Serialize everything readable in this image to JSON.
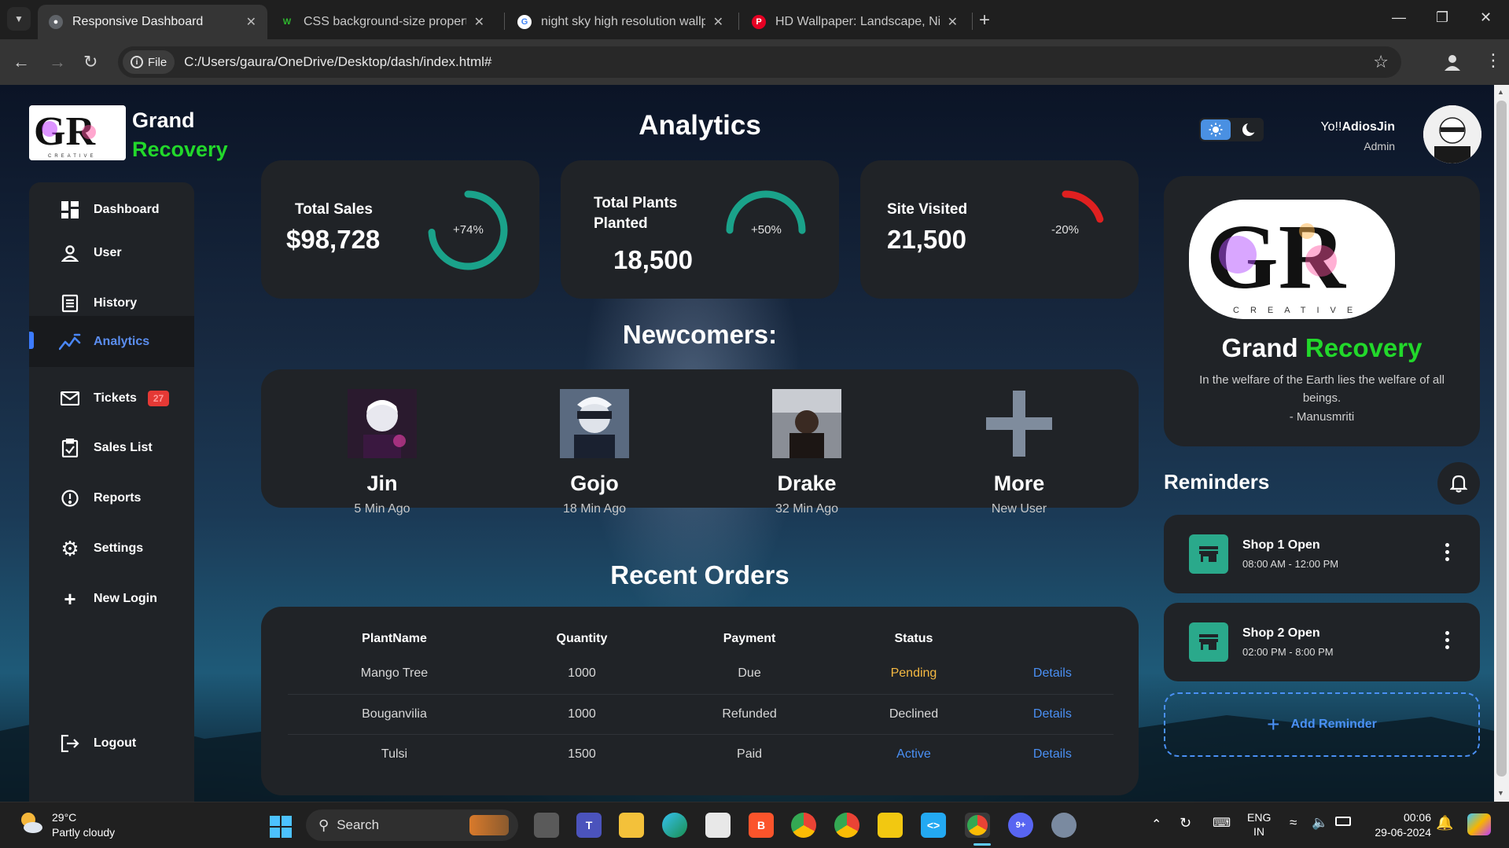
{
  "browser": {
    "tabs": [
      {
        "title": "Responsive Dashboard",
        "active": true
      },
      {
        "title": "CSS background-size property",
        "active": false
      },
      {
        "title": "night sky high resolution wallpa",
        "active": false
      },
      {
        "title": "HD Wallpaper: Landscape, Nigh",
        "active": false
      }
    ],
    "site_chip": "File",
    "url": "C:/Users/gaura/OneDrive/Desktop/dash/index.html#"
  },
  "brand": {
    "line1": "Grand",
    "line2": "Recovery"
  },
  "sidebar": {
    "items": [
      {
        "label": "Dashboard",
        "icon": "dashboard-icon"
      },
      {
        "label": "User",
        "icon": "user-icon"
      },
      {
        "label": "History",
        "icon": "history-icon"
      },
      {
        "label": "Analytics",
        "icon": "analytics-icon",
        "active": true
      },
      {
        "label": "Tickets",
        "icon": "mail-icon",
        "badge": "27"
      },
      {
        "label": "Sales List",
        "icon": "clipboard-icon"
      },
      {
        "label": "Reports",
        "icon": "report-icon"
      },
      {
        "label": "Settings",
        "icon": "gear-icon"
      },
      {
        "label": "New Login",
        "icon": "plus-icon"
      },
      {
        "label": "Logout",
        "icon": "logout-icon"
      }
    ]
  },
  "main": {
    "title": "Analytics",
    "stats": [
      {
        "label": "Total Sales",
        "value": "$98,728",
        "change": "+74%",
        "fraction": 0.74,
        "color": "#1aa28a"
      },
      {
        "label_line1": "Total Plants",
        "label_line2": "Planted",
        "value": "18,500",
        "change": "+50%",
        "fraction": 0.5,
        "color": "#1aa28a"
      },
      {
        "label": "Site Visited",
        "value": "21,500",
        "change": "-20%",
        "fraction": 0.2,
        "color": "#e02020"
      }
    ],
    "newcomers_title": "Newcomers:",
    "newcomers": [
      {
        "name": "Jin",
        "time": "5 Min Ago"
      },
      {
        "name": "Gojo",
        "time": "18 Min Ago"
      },
      {
        "name": "Drake",
        "time": "32 Min Ago"
      },
      {
        "name": "More",
        "time": "New User"
      }
    ],
    "orders_title": "Recent Orders",
    "orders": {
      "headers": [
        "PlantName",
        "Quantity",
        "Payment",
        "Status",
        ""
      ],
      "rows": [
        {
          "plant": "Mango Tree",
          "qty": "1000",
          "payment": "Due",
          "status": "Pending",
          "link": "Details"
        },
        {
          "plant": "Bouganvilia",
          "qty": "1000",
          "payment": "Refunded",
          "status": "Declined",
          "link": "Details"
        },
        {
          "plant": "Tulsi",
          "qty": "1500",
          "payment": "Paid",
          "status": "Active",
          "link": "Details"
        }
      ]
    }
  },
  "right": {
    "greeting_prefix": "Yo!!",
    "username": "AdiosJin",
    "role": "Admin",
    "profile_name_1": "Grand",
    "profile_name_2": "Recovery",
    "quote": "In the welfare of the Earth lies the welfare of all beings.",
    "quote_author": "- Manusmriti",
    "reminders_title": "Reminders",
    "reminders": [
      {
        "title": "Shop 1 Open",
        "time": "08:00 AM - 12:00 PM"
      },
      {
        "title": "Shop 2 Open",
        "time": "02:00 PM - 8:00 PM"
      }
    ],
    "add_reminder": "Add Reminder",
    "accent_green": "#22d82b",
    "accent_blue": "#4a90f5"
  },
  "taskbar": {
    "temp": "29°C",
    "weather": "Partly cloudy",
    "search": "Search",
    "lang1": "ENG",
    "lang2": "IN",
    "time": "00:06",
    "date": "29-06-2024",
    "discord_badge": "9+"
  }
}
